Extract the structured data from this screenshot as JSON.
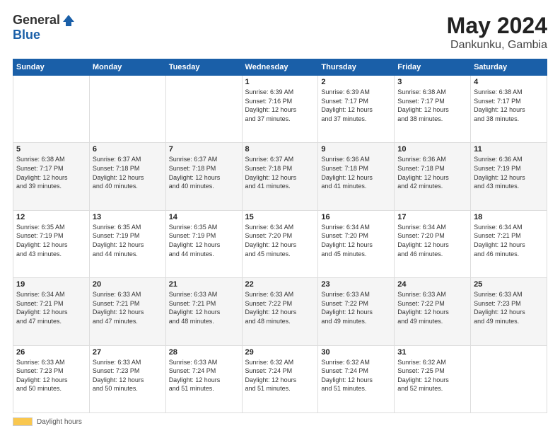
{
  "header": {
    "logo_general": "General",
    "logo_blue": "Blue",
    "title": "May 2024",
    "location": "Dankunku, Gambia"
  },
  "days_of_week": [
    "Sunday",
    "Monday",
    "Tuesday",
    "Wednesday",
    "Thursday",
    "Friday",
    "Saturday"
  ],
  "footer": {
    "label": "Daylight hours"
  },
  "weeks": [
    {
      "id": "week1",
      "days": [
        {
          "num": "",
          "info": ""
        },
        {
          "num": "",
          "info": ""
        },
        {
          "num": "",
          "info": ""
        },
        {
          "num": "1",
          "info": "Sunrise: 6:39 AM\nSunset: 7:16 PM\nDaylight: 12 hours\nand 37 minutes."
        },
        {
          "num": "2",
          "info": "Sunrise: 6:39 AM\nSunset: 7:17 PM\nDaylight: 12 hours\nand 37 minutes."
        },
        {
          "num": "3",
          "info": "Sunrise: 6:38 AM\nSunset: 7:17 PM\nDaylight: 12 hours\nand 38 minutes."
        },
        {
          "num": "4",
          "info": "Sunrise: 6:38 AM\nSunset: 7:17 PM\nDaylight: 12 hours\nand 38 minutes."
        }
      ]
    },
    {
      "id": "week2",
      "days": [
        {
          "num": "5",
          "info": "Sunrise: 6:38 AM\nSunset: 7:17 PM\nDaylight: 12 hours\nand 39 minutes."
        },
        {
          "num": "6",
          "info": "Sunrise: 6:37 AM\nSunset: 7:18 PM\nDaylight: 12 hours\nand 40 minutes."
        },
        {
          "num": "7",
          "info": "Sunrise: 6:37 AM\nSunset: 7:18 PM\nDaylight: 12 hours\nand 40 minutes."
        },
        {
          "num": "8",
          "info": "Sunrise: 6:37 AM\nSunset: 7:18 PM\nDaylight: 12 hours\nand 41 minutes."
        },
        {
          "num": "9",
          "info": "Sunrise: 6:36 AM\nSunset: 7:18 PM\nDaylight: 12 hours\nand 41 minutes."
        },
        {
          "num": "10",
          "info": "Sunrise: 6:36 AM\nSunset: 7:18 PM\nDaylight: 12 hours\nand 42 minutes."
        },
        {
          "num": "11",
          "info": "Sunrise: 6:36 AM\nSunset: 7:19 PM\nDaylight: 12 hours\nand 43 minutes."
        }
      ]
    },
    {
      "id": "week3",
      "days": [
        {
          "num": "12",
          "info": "Sunrise: 6:35 AM\nSunset: 7:19 PM\nDaylight: 12 hours\nand 43 minutes."
        },
        {
          "num": "13",
          "info": "Sunrise: 6:35 AM\nSunset: 7:19 PM\nDaylight: 12 hours\nand 44 minutes."
        },
        {
          "num": "14",
          "info": "Sunrise: 6:35 AM\nSunset: 7:19 PM\nDaylight: 12 hours\nand 44 minutes."
        },
        {
          "num": "15",
          "info": "Sunrise: 6:34 AM\nSunset: 7:20 PM\nDaylight: 12 hours\nand 45 minutes."
        },
        {
          "num": "16",
          "info": "Sunrise: 6:34 AM\nSunset: 7:20 PM\nDaylight: 12 hours\nand 45 minutes."
        },
        {
          "num": "17",
          "info": "Sunrise: 6:34 AM\nSunset: 7:20 PM\nDaylight: 12 hours\nand 46 minutes."
        },
        {
          "num": "18",
          "info": "Sunrise: 6:34 AM\nSunset: 7:21 PM\nDaylight: 12 hours\nand 46 minutes."
        }
      ]
    },
    {
      "id": "week4",
      "days": [
        {
          "num": "19",
          "info": "Sunrise: 6:34 AM\nSunset: 7:21 PM\nDaylight: 12 hours\nand 47 minutes."
        },
        {
          "num": "20",
          "info": "Sunrise: 6:33 AM\nSunset: 7:21 PM\nDaylight: 12 hours\nand 47 minutes."
        },
        {
          "num": "21",
          "info": "Sunrise: 6:33 AM\nSunset: 7:21 PM\nDaylight: 12 hours\nand 48 minutes."
        },
        {
          "num": "22",
          "info": "Sunrise: 6:33 AM\nSunset: 7:22 PM\nDaylight: 12 hours\nand 48 minutes."
        },
        {
          "num": "23",
          "info": "Sunrise: 6:33 AM\nSunset: 7:22 PM\nDaylight: 12 hours\nand 49 minutes."
        },
        {
          "num": "24",
          "info": "Sunrise: 6:33 AM\nSunset: 7:22 PM\nDaylight: 12 hours\nand 49 minutes."
        },
        {
          "num": "25",
          "info": "Sunrise: 6:33 AM\nSunset: 7:23 PM\nDaylight: 12 hours\nand 49 minutes."
        }
      ]
    },
    {
      "id": "week5",
      "days": [
        {
          "num": "26",
          "info": "Sunrise: 6:33 AM\nSunset: 7:23 PM\nDaylight: 12 hours\nand 50 minutes."
        },
        {
          "num": "27",
          "info": "Sunrise: 6:33 AM\nSunset: 7:23 PM\nDaylight: 12 hours\nand 50 minutes."
        },
        {
          "num": "28",
          "info": "Sunrise: 6:33 AM\nSunset: 7:24 PM\nDaylight: 12 hours\nand 51 minutes."
        },
        {
          "num": "29",
          "info": "Sunrise: 6:32 AM\nSunset: 7:24 PM\nDaylight: 12 hours\nand 51 minutes."
        },
        {
          "num": "30",
          "info": "Sunrise: 6:32 AM\nSunset: 7:24 PM\nDaylight: 12 hours\nand 51 minutes."
        },
        {
          "num": "31",
          "info": "Sunrise: 6:32 AM\nSunset: 7:25 PM\nDaylight: 12 hours\nand 52 minutes."
        },
        {
          "num": "",
          "info": ""
        }
      ]
    }
  ]
}
